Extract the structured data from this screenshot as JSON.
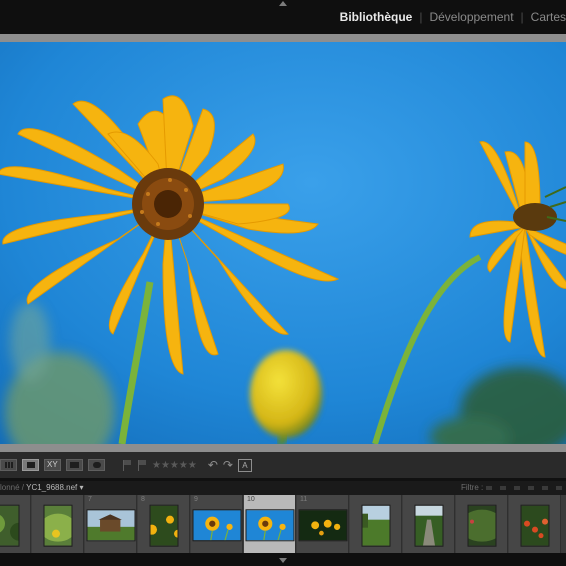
{
  "modules": {
    "library": "Bibliothèque",
    "develop": "Développement",
    "map": "Cartes"
  },
  "toolbar": {
    "survey_label": "XY",
    "stars": "★★★★★",
    "rotate_left": "↶",
    "rotate_right": "↷",
    "face_label": "A"
  },
  "filmstrip": {
    "source_prefix": "lonné /",
    "file_name": "YC1_9688.nef",
    "dropdown": "▾",
    "filter_label": "Filtre :",
    "thumbnails": [
      {
        "index": "",
        "kind": "garden",
        "selected": false
      },
      {
        "index": "",
        "kind": "plant",
        "selected": false
      },
      {
        "index": "7",
        "kind": "shed",
        "selected": false
      },
      {
        "index": "8",
        "kind": "flowers",
        "selected": false
      },
      {
        "index": "9",
        "kind": "sunflower-sky",
        "selected": false
      },
      {
        "index": "10",
        "kind": "sunflower-sky",
        "selected": true
      },
      {
        "index": "11",
        "kind": "flowers-dark",
        "selected": false
      },
      {
        "index": "",
        "kind": "meadow",
        "selected": false
      },
      {
        "index": "",
        "kind": "path",
        "selected": false
      },
      {
        "index": "",
        "kind": "bush",
        "selected": false
      },
      {
        "index": "",
        "kind": "berries",
        "selected": false
      }
    ]
  },
  "colors": {
    "sky": "#1f86d6",
    "petal": "#f6b40f",
    "stem": "#7bb33a",
    "selected_cell": "#b9b9b9"
  }
}
